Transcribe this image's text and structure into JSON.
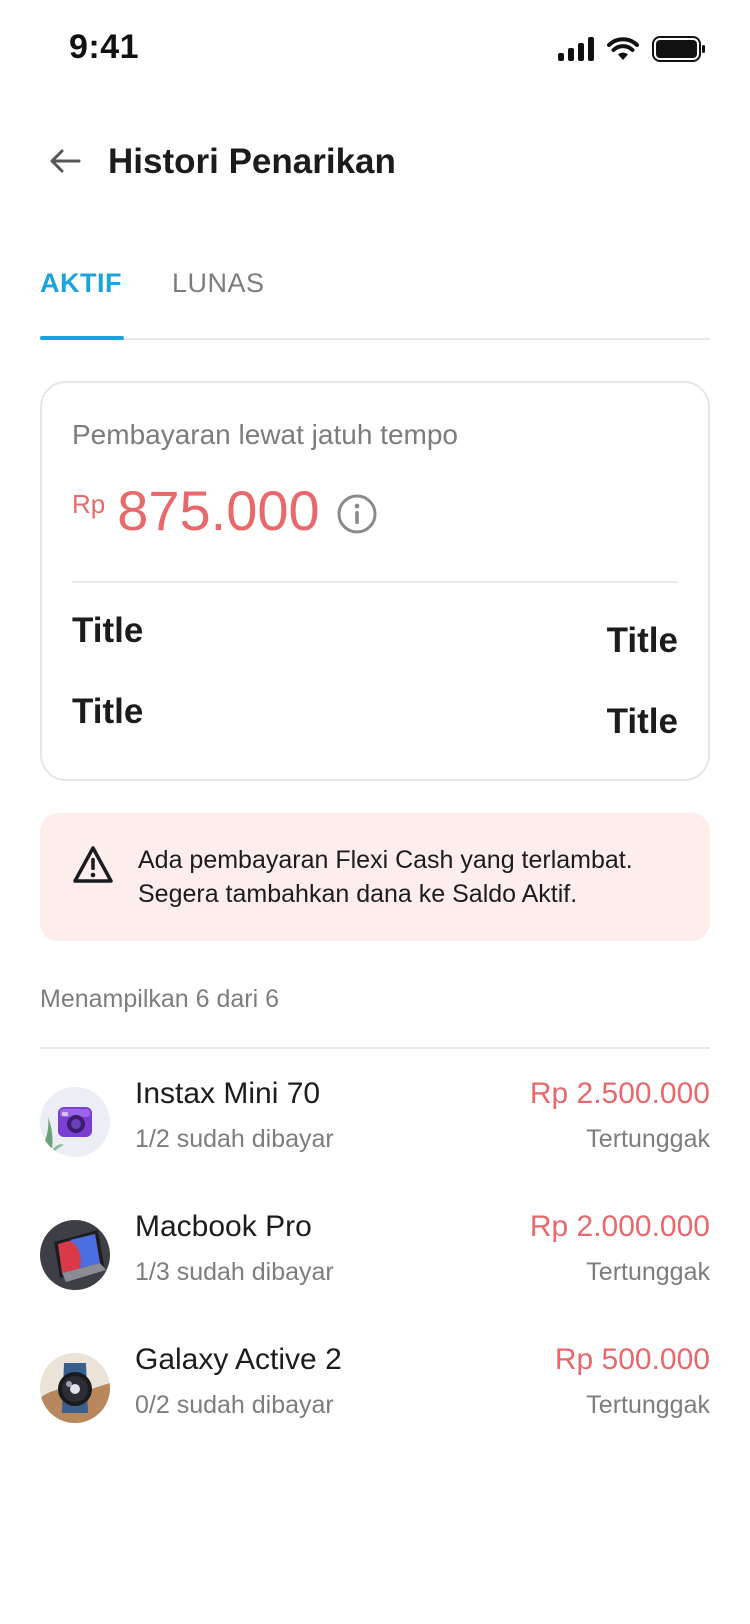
{
  "status_bar": {
    "time": "9:41"
  },
  "header": {
    "title": "Histori Penarikan",
    "back_icon": "arrow-left-icon"
  },
  "tabs": [
    {
      "label": "AKTIF",
      "active": true
    },
    {
      "label": "LUNAS",
      "active": false
    }
  ],
  "summary": {
    "label": "Pembayaran lewat jatuh tempo",
    "currency": "Rp",
    "amount": "875.000",
    "rows": [
      {
        "left": "Title",
        "right": "Title"
      },
      {
        "left": "Title",
        "right": "Title"
      }
    ]
  },
  "alert": {
    "icon": "warning-icon",
    "line1": "Ada pembayaran Flexi Cash yang terlambat.",
    "line2": "Segera tambahkan dana ke Saldo Aktif."
  },
  "list": {
    "count_text": "Menampilkan 6 dari 6",
    "items": [
      {
        "name": "Instax Mini 70",
        "sub": "1/2 sudah dibayar",
        "amount": "Rp 2.500.000",
        "status": "Tertunggak"
      },
      {
        "name": "Macbook Pro",
        "sub": "1/3 sudah dibayar",
        "amount": "Rp 2.000.000",
        "status": "Tertunggak"
      },
      {
        "name": "Galaxy Active 2",
        "sub": "0/2 sudah dibayar",
        "amount": "Rp 500.000",
        "status": "Tertunggak"
      }
    ]
  },
  "colors": {
    "accent": "#1ba3dc",
    "overdue": "#e8696b",
    "alert_bg": "#fdeeed",
    "muted_text": "#7d7d7d"
  }
}
